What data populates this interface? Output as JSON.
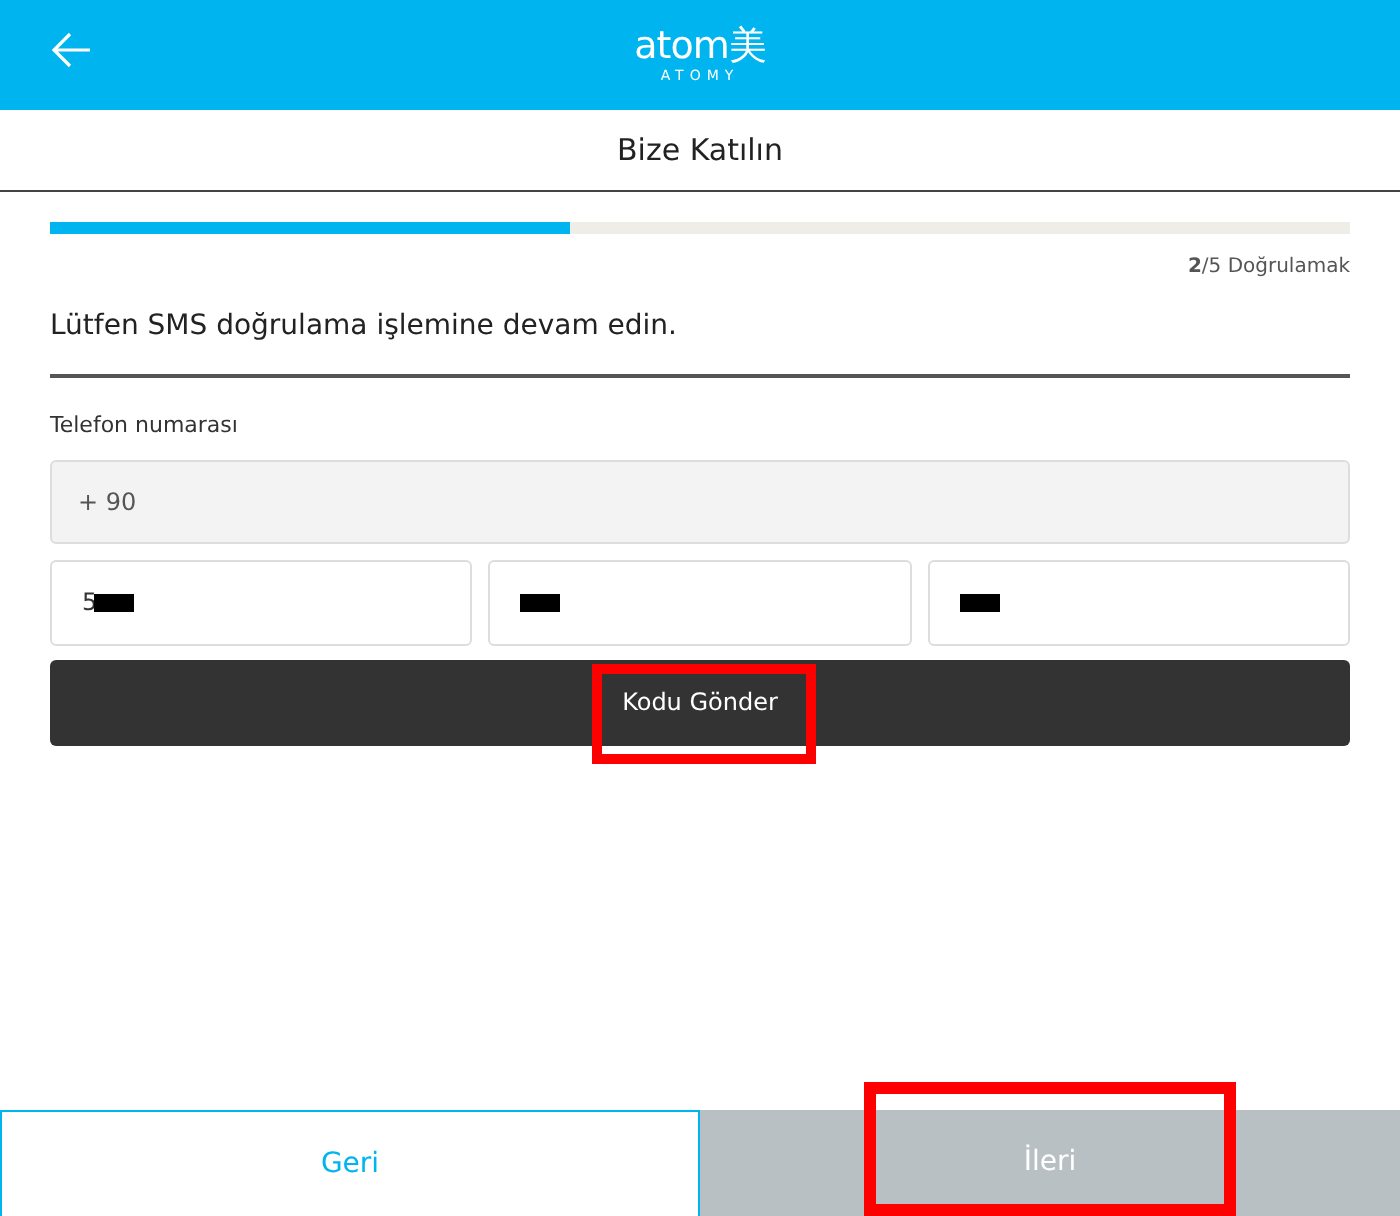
{
  "header": {
    "logo": "atom美",
    "logo_subtitle": "ATOMY"
  },
  "page_title": "Bize Katılın",
  "progress": {
    "level": 0.4,
    "step": "**2**/5 Doğrulamak"
  },
  "heading": "Lütfen SMS doğrulama işlemine devam edin.",
  "phone": {
    "label": "Telefon numarası",
    "country_code": "+ 90",
    "parts": [
      {
        "value": "5",
        "redacted": true
      },
      {
        "redacted": true
      },
      {
        "redacted": true
      }
    ]
  },
  "send_button": {
    "label": "Kodu Gönder",
    "highlighted": true
  },
  "footer": [
    {
      "label": "Geri",
      "disabled": false,
      "highlighted": false
    },
    {
      "label": "İleri",
      "disabled": true,
      "highlighted": true
    }
  ]
}
